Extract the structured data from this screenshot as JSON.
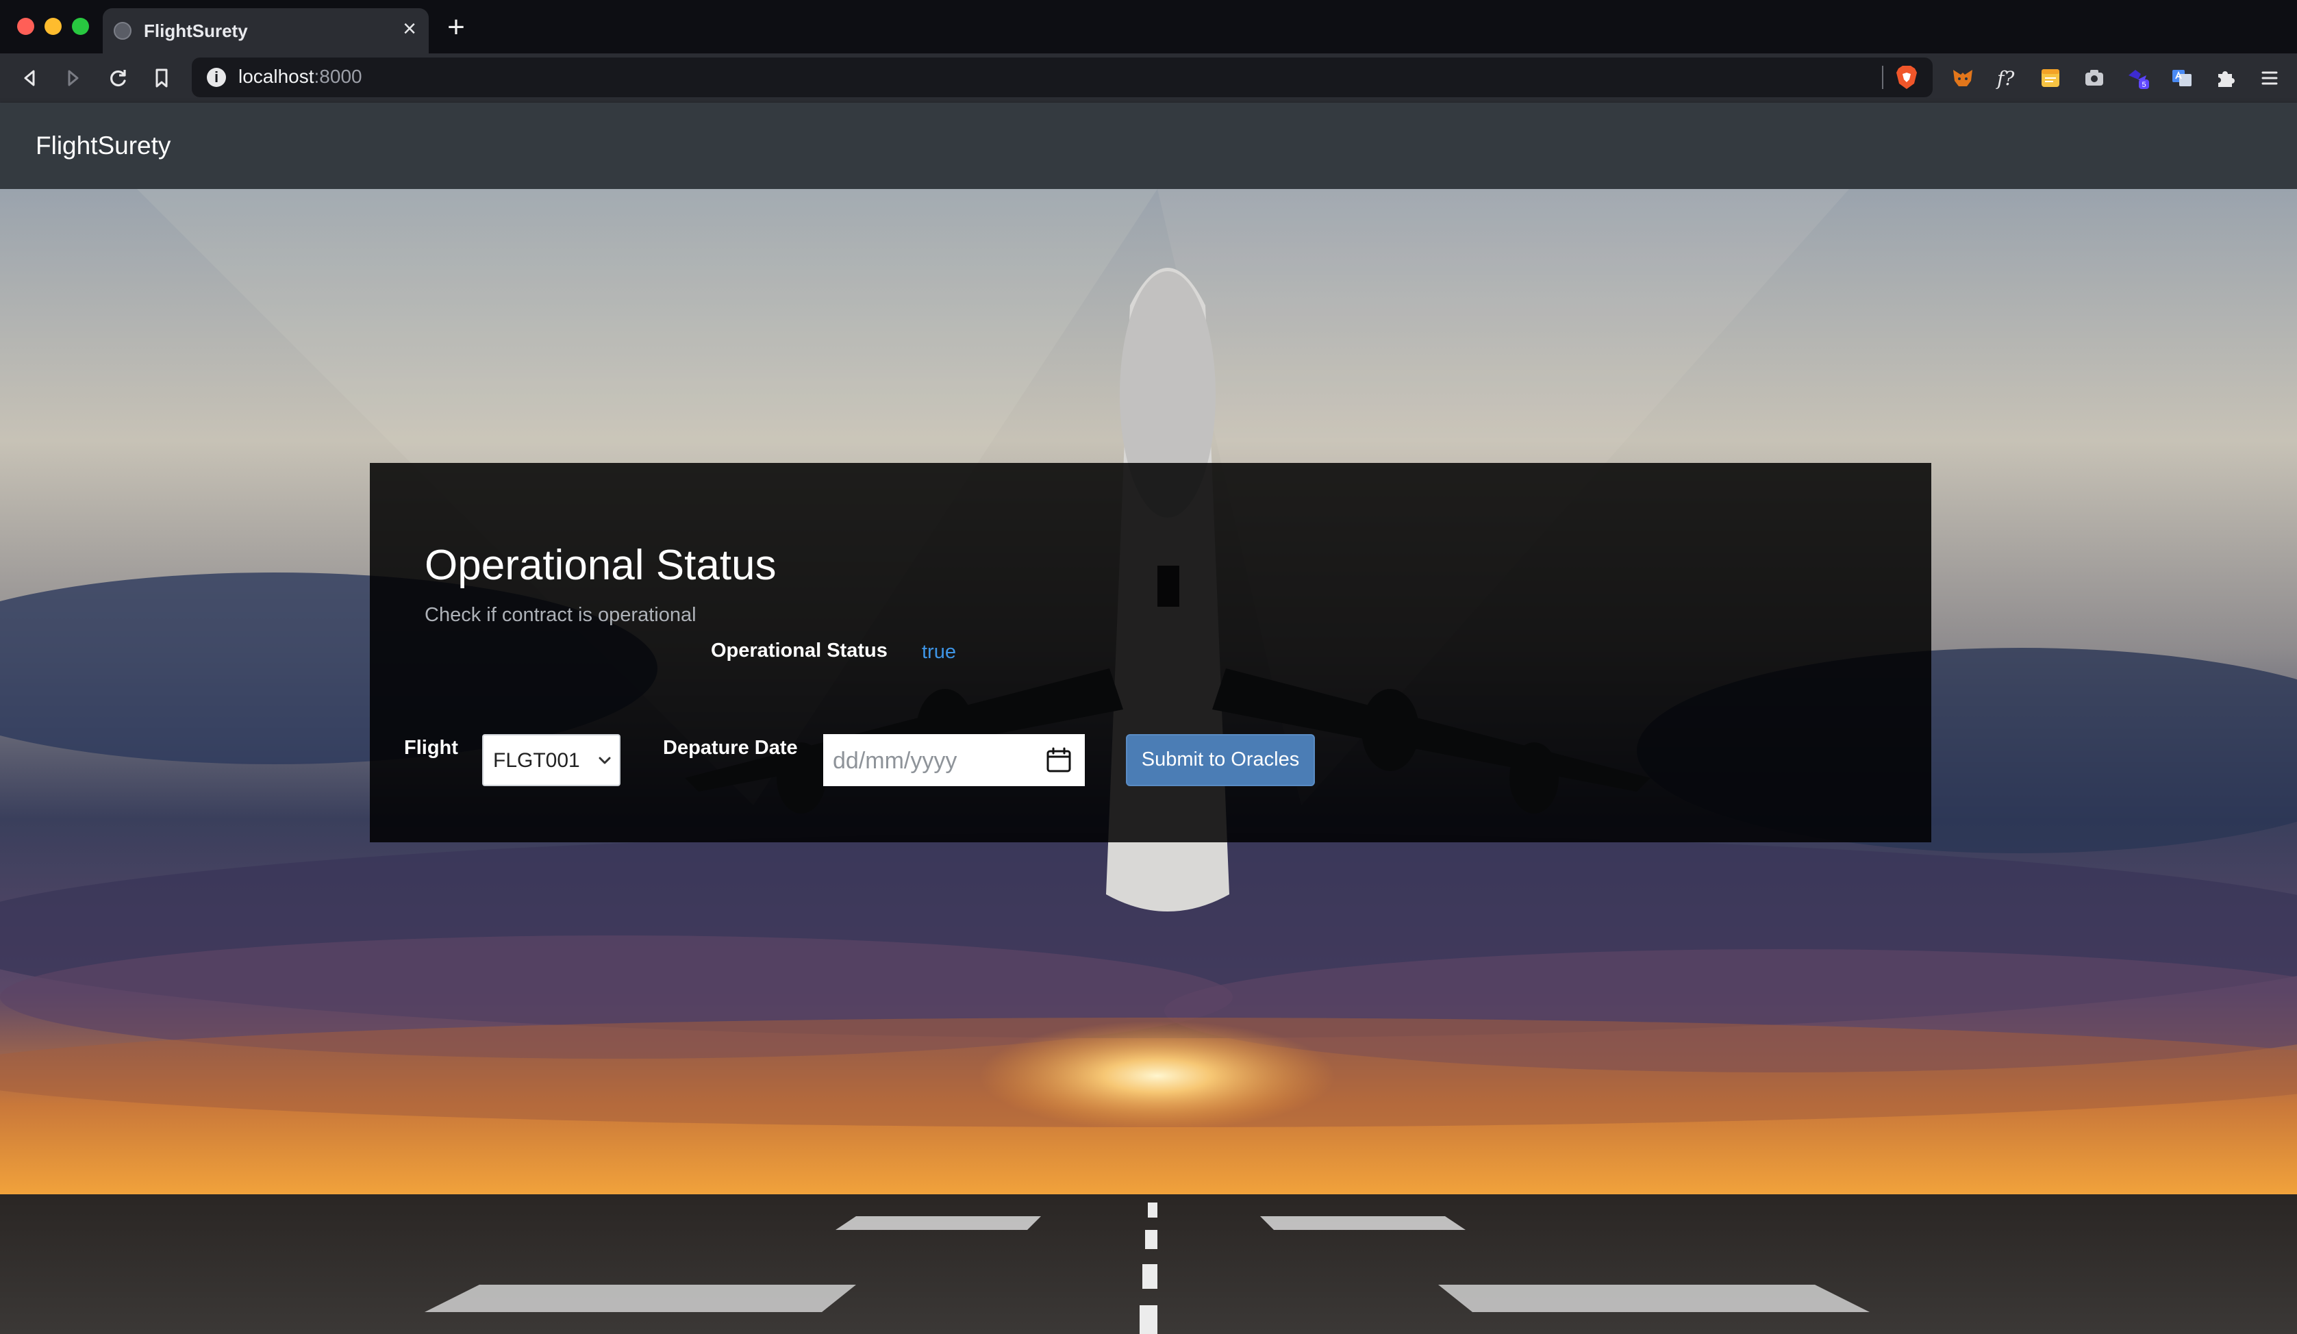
{
  "browser": {
    "tab_title": "FlightSurety",
    "url_host": "localhost",
    "url_port": ":8000",
    "info_icon": "i",
    "tab_close": "×",
    "new_tab": "+",
    "extension_badge": "5"
  },
  "app": {
    "brand": "FlightSurety"
  },
  "panel": {
    "title": "Operational Status",
    "subtitle": "Check if contract is operational",
    "status_label": "Operational Status",
    "status_value": "true"
  },
  "form": {
    "flight_label": "Flight",
    "flight_selected": "FLGT001",
    "date_label": "Depature Date",
    "date_placeholder": "dd/mm/yyyy",
    "submit_label": "Submit to Oracles"
  },
  "colors": {
    "navbar": "#343a40",
    "status_value": "#3e95e6",
    "submit_button": "#4b7db5"
  }
}
